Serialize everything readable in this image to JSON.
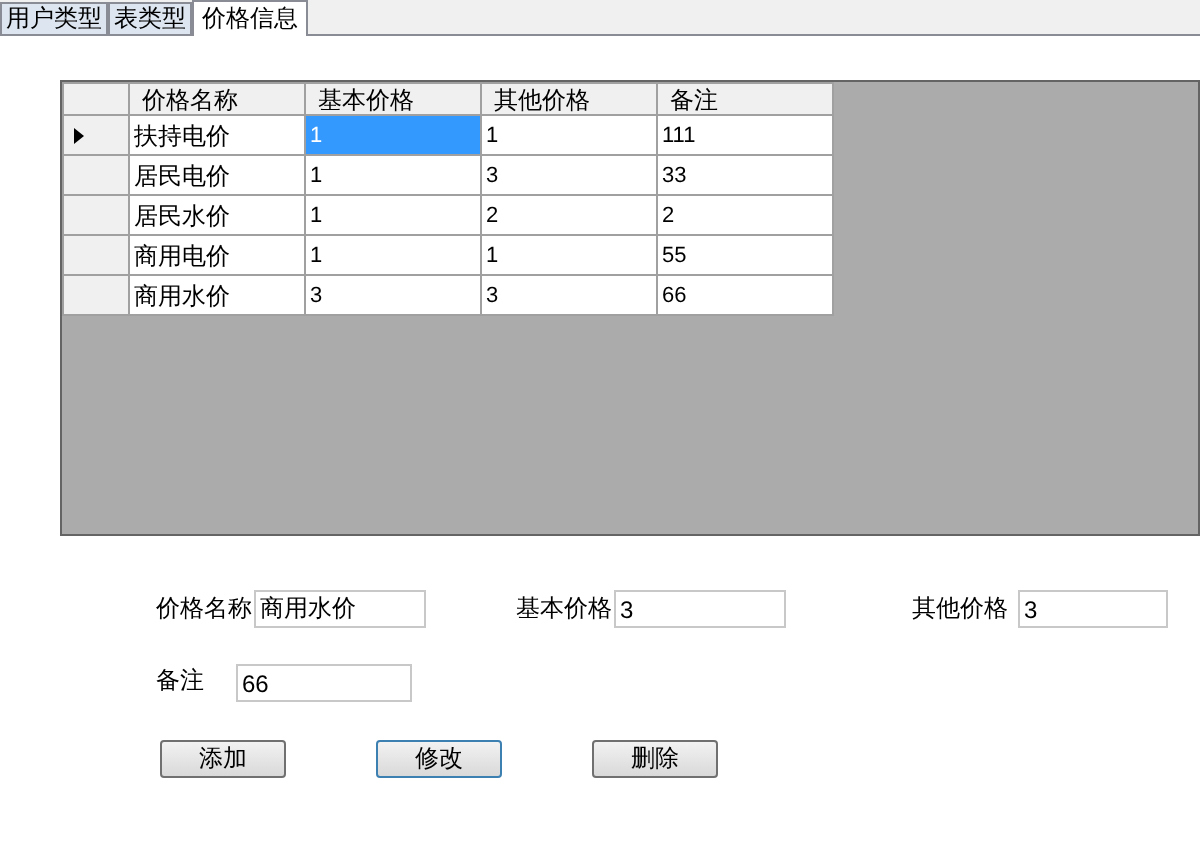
{
  "tabs": [
    {
      "label": "用户类型",
      "selected": false
    },
    {
      "label": "表类型",
      "selected": false
    },
    {
      "label": "价格信息",
      "selected": true
    }
  ],
  "table": {
    "columns": [
      "价格名称",
      "基本价格",
      "其他价格",
      "备注"
    ],
    "rows": [
      {
        "selected": true,
        "cells": [
          {
            "text": "扶持电价",
            "selected": false
          },
          {
            "text": "1",
            "selected": true
          },
          {
            "text": "1",
            "selected": false
          },
          {
            "text": "111",
            "selected": false
          }
        ]
      },
      {
        "selected": false,
        "cells": [
          {
            "text": "居民电价",
            "selected": false
          },
          {
            "text": "1",
            "selected": false
          },
          {
            "text": "3",
            "selected": false
          },
          {
            "text": "33",
            "selected": false
          }
        ]
      },
      {
        "selected": false,
        "cells": [
          {
            "text": "居民水价",
            "selected": false
          },
          {
            "text": "1",
            "selected": false
          },
          {
            "text": "2",
            "selected": false
          },
          {
            "text": "2",
            "selected": false
          }
        ]
      },
      {
        "selected": false,
        "cells": [
          {
            "text": "商用电价",
            "selected": false
          },
          {
            "text": "1",
            "selected": false
          },
          {
            "text": "1",
            "selected": false
          },
          {
            "text": "55",
            "selected": false
          }
        ]
      },
      {
        "selected": false,
        "cells": [
          {
            "text": "商用水价",
            "selected": false
          },
          {
            "text": "3",
            "selected": false
          },
          {
            "text": "3",
            "selected": false
          },
          {
            "text": "66",
            "selected": false
          }
        ]
      }
    ]
  },
  "form": {
    "price_name": {
      "label": "价格名称",
      "value": "商用水价"
    },
    "base_price": {
      "label": "基本价格",
      "value": "3"
    },
    "other_price": {
      "label": "其他价格",
      "value": "3"
    },
    "remark": {
      "label": "备注",
      "value": "66"
    }
  },
  "buttons": [
    {
      "label": "添加",
      "focused": false
    },
    {
      "label": "修改",
      "focused": true
    },
    {
      "label": "删除",
      "focused": false
    }
  ]
}
